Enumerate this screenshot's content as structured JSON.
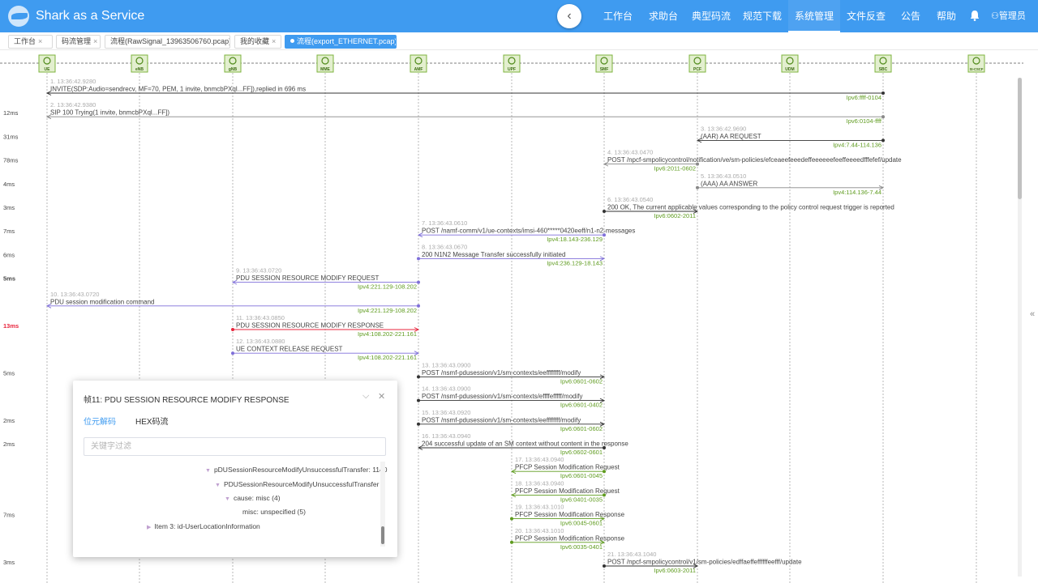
{
  "app": {
    "title": "Shark as a Service"
  },
  "colors": {
    "header": "#3f9bf0",
    "violet": "#7f6fd9",
    "red": "#e8253d",
    "dark": "#333333",
    "green": "#5e9b1e",
    "grey": "#888888",
    "nodeFill": "#e3efcf",
    "nodeStroke": "#7eb33c"
  },
  "nav": [
    {
      "label": "工作台"
    },
    {
      "label": "求助台"
    },
    {
      "label": "典型码流"
    },
    {
      "label": "规范下载"
    },
    {
      "label": "系统管理",
      "active": true
    },
    {
      "label": "文件反查"
    },
    {
      "label": "公告"
    },
    {
      "label": "帮助"
    }
  ],
  "user": {
    "label": "管理员"
  },
  "tabs": [
    {
      "label": "工作台"
    },
    {
      "label": "码流管理"
    },
    {
      "label": "流程(RawSignal_13963506760.pcap)"
    },
    {
      "label": "我的收藏"
    },
    {
      "label": "流程(export_ETHERNET.pcap)",
      "active": true
    }
  ],
  "nodes": [
    "UE",
    "eNB",
    "gNB",
    "MME",
    "AMF",
    "UPF",
    "SMF",
    "PCF",
    "UDM",
    "SBC",
    "SI-CSCF"
  ],
  "messages": [
    {
      "n": 1,
      "time": "13:36:42.9280",
      "label": "INVITE(SDP:Audio=sendrecv, MF=70, PEM, 1 invite, bnmcbPXql...FF]),replied in 696 ms",
      "from": 9,
      "to": 0,
      "addr": "Ipv6:ffff-0104",
      "delta": "",
      "color": "dark"
    },
    {
      "n": 2,
      "time": "13:36:42.9380",
      "label": "SIP 100 Trying(1 invite, bnmcbPXql...FF])",
      "from": 9,
      "to": 0,
      "addr": "Ipv6:0104-ffff",
      "delta": "12ms",
      "color": "grey"
    },
    {
      "n": 3,
      "time": "13:36:42.9690",
      "label": "(AAR) AA REQUEST",
      "from": 9,
      "to": 7,
      "addr": "Ipv4:7.44-114.136",
      "delta": "31ms",
      "color": "dark"
    },
    {
      "n": 4,
      "time": "13:36:43.0470",
      "label": "POST /npcf-smpolicycontrol/notification/ve/sm-policies/efceaeefeeedeffeeeeeefeeffeeeedfffefef/update",
      "from": 7,
      "to": 6,
      "addr": "Ipv6:2011-0602",
      "delta": "78ms",
      "color": "grey"
    },
    {
      "n": 5,
      "time": "13:36:43.0510",
      "label": "(AAA) AA ANSWER",
      "from": 7,
      "to": 9,
      "addr": "Ipv4:114.136-7.44",
      "delta": "4ms",
      "color": "grey"
    },
    {
      "n": 6,
      "time": "13:36:43.0540",
      "label": "200 OK, The current applicable values corresponding to the policy control request trigger is reported",
      "from": 6,
      "to": 7,
      "addr": "Ipv6:0602-2011",
      "delta": "3ms",
      "color": "dark"
    },
    {
      "n": 7,
      "time": "13:36:43.0610",
      "label": "POST /namf-comm/v1/ue-contexts/imsi-460*****0420eeff/n1-n2-messages",
      "from": 6,
      "to": 4,
      "addr": "Ipv4:18.143-236.129",
      "delta": "7ms",
      "color": "violet"
    },
    {
      "n": 8,
      "time": "13:36:43.0670",
      "label": "200 N1N2 Message Transfer successfully initiated",
      "from": 4,
      "to": 6,
      "addr": "Ipv4:236.129-18.143",
      "delta": "6ms",
      "color": "violet"
    },
    {
      "n": 9,
      "time": "13:36:43.0720",
      "label": "PDU SESSION RESOURCE MODIFY REQUEST",
      "from": 4,
      "to": 2,
      "addr": "Ipv4:221.129-108.202",
      "delta": "5ms",
      "color": "violet"
    },
    {
      "n": 10,
      "time": "13:36:43.0720",
      "label": "PDU session modification command",
      "from": 4,
      "to": 0,
      "addr": "Ipv4:221.129-108.202",
      "delta": "",
      "color": "violet"
    },
    {
      "n": 11,
      "time": "13:36:43.0850",
      "label": "PDU SESSION RESOURCE MODIFY RESPONSE",
      "from": 2,
      "to": 4,
      "addr": "Ipv4:108.202-221.161",
      "delta": "13ms",
      "color": "red"
    },
    {
      "n": 12,
      "time": "13:36:43.0880",
      "label": "UE CONTEXT RELEASE REQUEST",
      "from": 2,
      "to": 4,
      "addr": "Ipv4:108.202-221.161",
      "delta": "",
      "color": "violet"
    },
    {
      "n": 13,
      "time": "13:36:43.0900",
      "label": "POST /nsmf-pdusession/v1/sm-contexts/eeffffffff/modify",
      "from": 4,
      "to": 6,
      "addr": "Ipv6:0601-0602",
      "delta": "5ms",
      "color": "dark"
    },
    {
      "n": 14,
      "time": "13:36:43.0900",
      "label": "POST /nsmf-pdusession/v1/sm-contexts/effffefffff/modify",
      "from": 4,
      "to": 6,
      "addr": "Ipv6:0601-0402",
      "delta": "",
      "color": "dark"
    },
    {
      "n": 15,
      "time": "13:36:43.0920",
      "label": "POST /nsmf-pdusession/v1/sm-contexts/eeffffffff/modify",
      "from": 4,
      "to": 6,
      "addr": "Ipv6:0601-0602",
      "delta": "2ms",
      "color": "dark"
    },
    {
      "n": 16,
      "time": "13:36:43.0940",
      "label": "204 successful update of an SM context without content in the response",
      "from": 6,
      "to": 4,
      "addr": "Ipv6:0602-0601",
      "delta": "2ms",
      "color": "dark"
    },
    {
      "n": 17,
      "time": "13:36:43.0940",
      "label": "PFCP Session Modification Request",
      "from": 6,
      "to": 5,
      "addr": "Ipv6:0601-0045",
      "delta": "",
      "color": "green"
    },
    {
      "n": 18,
      "time": "13:36:43.0940",
      "label": "PFCP Session Modification Request",
      "from": 6,
      "to": 5,
      "addr": "Ipv6:0401-0035",
      "delta": "",
      "color": "green"
    },
    {
      "n": 19,
      "time": "13:36:43.1010",
      "label": "PFCP Session Modification Response",
      "from": 5,
      "to": 6,
      "addr": "Ipv6:0045-0601",
      "delta": "7ms",
      "color": "green"
    },
    {
      "n": 20,
      "time": "13:36:43.1010",
      "label": "PFCP Session Modification Response",
      "from": 5,
      "to": 6,
      "addr": "Ipv6:0035-0401",
      "delta": "",
      "color": "green"
    },
    {
      "n": 21,
      "time": "13:36:43.1040",
      "label": "POST /npcf-smpolicycontrol/v1/sm-policies/edffaeffeffffffeefff/update",
      "from": 6,
      "to": 7,
      "addr": "Ipv6:0603-2011",
      "delta": "3ms",
      "color": "dark"
    }
  ],
  "popup": {
    "title": "帧11:  PDU SESSION RESOURCE MODIFY RESPONSE",
    "tab_bits": "位元解码",
    "tab_hex": "HEX码流",
    "filter_placeholder": "关键字过滤",
    "tree": [
      {
        "text": "pDUSessionResourceModifyUnsuccessfulTransfer: 1140",
        "level": 0
      },
      {
        "text": "PDUSessionResourceModifyUnsuccessfulTransfer",
        "level": 1
      },
      {
        "text": "cause: misc (4)",
        "level": 2
      },
      {
        "text": "misc: unspecified (5)",
        "level": 3
      },
      {
        "text": "Item 3: id-UserLocationInformation",
        "level": -1
      }
    ]
  }
}
